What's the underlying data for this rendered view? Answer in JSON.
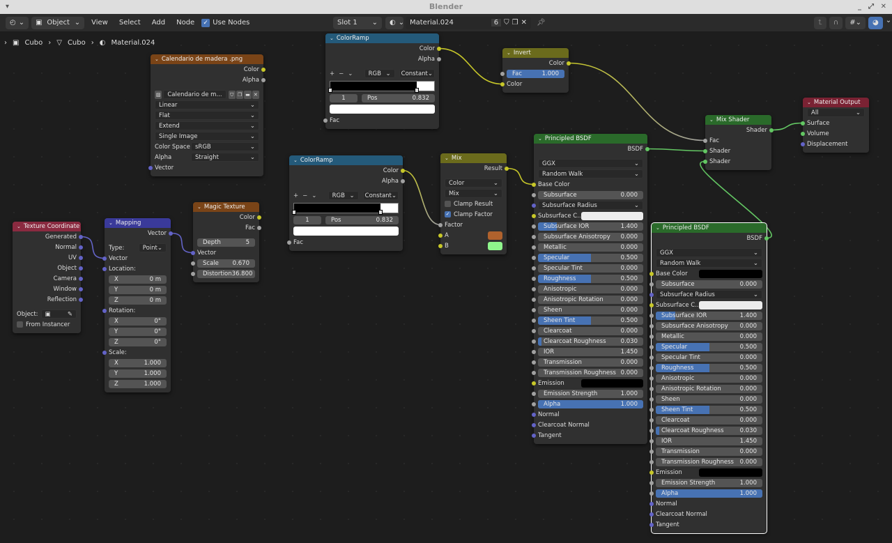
{
  "window": {
    "title": "Blender"
  },
  "header": {
    "editor_icon": "node-editor-icon",
    "object_mode": "Object",
    "menus": [
      "View",
      "Select",
      "Add",
      "Node"
    ],
    "use_nodes_label": "Use Nodes",
    "use_nodes": true,
    "slot": "Slot 1",
    "material": "Material.024",
    "users": "6"
  },
  "breadcrumb": [
    "Cubo",
    "Cubo",
    "Material.024"
  ],
  "colors": {
    "color_socket": "#c7c729",
    "float_socket": "#a1a1a1",
    "vector_socket": "#6363c7",
    "shader_socket": "#63c763",
    "link_default": "#c4c4c4",
    "accent": "#4772b3"
  },
  "nodes": [
    {
      "id": "image",
      "title": "Calendario de madera .png",
      "header": "#7a4417",
      "rows": [
        {
          "k": "out",
          "label": "Color",
          "socket": "color"
        },
        {
          "k": "out",
          "label": "Alpha",
          "socket": "float"
        },
        {
          "k": "gap"
        },
        {
          "k": "image",
          "label": "Calendario de m..."
        },
        {
          "k": "select",
          "label": "Linear"
        },
        {
          "k": "select",
          "label": "Flat"
        },
        {
          "k": "select",
          "label": "Extend"
        },
        {
          "k": "select",
          "label": "Single Image"
        },
        {
          "k": "prop",
          "label": "Color Space",
          "value": "sRGB"
        },
        {
          "k": "prop",
          "label": "Alpha",
          "value": "Straight"
        },
        {
          "k": "in",
          "label": "Vector",
          "socket": "vector"
        }
      ]
    },
    {
      "id": "ramp1",
      "title": "ColorRamp",
      "header": "#245a7a",
      "rows": [
        {
          "k": "out",
          "label": "Color",
          "socket": "color"
        },
        {
          "k": "out",
          "label": "Alpha",
          "socket": "float"
        },
        {
          "k": "gap"
        },
        {
          "k": "rampctl",
          "mode": "RGB",
          "interp": "Constant"
        },
        {
          "k": "ramp",
          "stops": [
            0,
            0.832
          ]
        },
        {
          "k": "rampstop",
          "index": "1",
          "pos_label": "Pos",
          "pos": "0.832"
        },
        {
          "k": "rampcolor",
          "color": "#ffffff"
        },
        {
          "k": "in",
          "label": "Fac",
          "socket": "float"
        }
      ]
    },
    {
      "id": "invert",
      "title": "Invert",
      "header": "#6b6b1c",
      "rows": [
        {
          "k": "out",
          "label": "Color",
          "socket": "color"
        },
        {
          "k": "value",
          "label": "Fac",
          "value": "1.000",
          "fill": 1,
          "socket": "float"
        },
        {
          "k": "in",
          "label": "Color",
          "socket": "color"
        }
      ]
    },
    {
      "id": "mixshader",
      "title": "Mix Shader",
      "header": "#2a6a2a",
      "rows": [
        {
          "k": "out",
          "label": "Shader",
          "socket": "shader"
        },
        {
          "k": "in",
          "label": "Fac",
          "socket": "float"
        },
        {
          "k": "in",
          "label": "Shader",
          "socket": "shader"
        },
        {
          "k": "in",
          "label": "Shader",
          "socket": "shader"
        }
      ]
    },
    {
      "id": "output",
      "title": "Material Output",
      "header": "#7a2233",
      "rows": [
        {
          "k": "select",
          "label": "All"
        },
        {
          "k": "in",
          "label": "Surface",
          "socket": "shader"
        },
        {
          "k": "in",
          "label": "Volume",
          "socket": "shader"
        },
        {
          "k": "in",
          "label": "Displacement",
          "socket": "vector"
        }
      ]
    },
    {
      "id": "texcoord",
      "title": "Texture Coordinate",
      "header": "#8a2a40",
      "rows": [
        {
          "k": "out",
          "label": "Generated",
          "socket": "vector"
        },
        {
          "k": "out",
          "label": "Normal",
          "socket": "vector"
        },
        {
          "k": "out",
          "label": "UV",
          "socket": "vector"
        },
        {
          "k": "out",
          "label": "Object",
          "socket": "vector"
        },
        {
          "k": "out",
          "label": "Camera",
          "socket": "vector"
        },
        {
          "k": "out",
          "label": "Window",
          "socket": "vector"
        },
        {
          "k": "out",
          "label": "Reflection",
          "socket": "vector"
        },
        {
          "k": "gap"
        },
        {
          "k": "object",
          "label": "Object:"
        },
        {
          "k": "check",
          "label": "From Instancer",
          "on": false
        }
      ]
    },
    {
      "id": "mapping",
      "title": "Mapping",
      "header": "#3a3a9a",
      "rows": [
        {
          "k": "out",
          "label": "Vector",
          "socket": "vector"
        },
        {
          "k": "gap"
        },
        {
          "k": "prop",
          "label": "Type:",
          "value": "Point"
        },
        {
          "k": "in",
          "label": "Vector",
          "socket": "vector"
        },
        {
          "k": "in",
          "label": "Location:",
          "socket": "vector"
        },
        {
          "k": "value",
          "label": "X",
          "value": "0 m"
        },
        {
          "k": "value",
          "label": "Y",
          "value": "0 m"
        },
        {
          "k": "value",
          "label": "Z",
          "value": "0 m"
        },
        {
          "k": "in",
          "label": "Rotation:",
          "socket": "vector"
        },
        {
          "k": "value",
          "label": "X",
          "value": "0°"
        },
        {
          "k": "value",
          "label": "Y",
          "value": "0°"
        },
        {
          "k": "value",
          "label": "Z",
          "value": "0°"
        },
        {
          "k": "in",
          "label": "Scale:",
          "socket": "vector"
        },
        {
          "k": "value",
          "label": "X",
          "value": "1.000"
        },
        {
          "k": "value",
          "label": "Y",
          "value": "1.000"
        },
        {
          "k": "value",
          "label": "Z",
          "value": "1.000"
        }
      ]
    },
    {
      "id": "magic",
      "title": "Magic Texture",
      "header": "#7a4417",
      "rows": [
        {
          "k": "out",
          "label": "Color",
          "socket": "color"
        },
        {
          "k": "out",
          "label": "Fac",
          "socket": "float"
        },
        {
          "k": "gap"
        },
        {
          "k": "value",
          "label": "Depth",
          "value": "5"
        },
        {
          "k": "in",
          "label": "Vector",
          "socket": "vector"
        },
        {
          "k": "value",
          "label": "Scale",
          "value": "0.670",
          "socket": "float"
        },
        {
          "k": "value",
          "label": "Distortion",
          "value": "36.800",
          "socket": "float"
        }
      ]
    },
    {
      "id": "ramp2",
      "title": "ColorRamp",
      "header": "#245a7a",
      "rows": [
        {
          "k": "out",
          "label": "Color",
          "socket": "color"
        },
        {
          "k": "out",
          "label": "Alpha",
          "socket": "float"
        },
        {
          "k": "gap"
        },
        {
          "k": "rampctl",
          "mode": "RGB",
          "interp": "Constant"
        },
        {
          "k": "ramp",
          "stops": [
            0,
            0.832
          ]
        },
        {
          "k": "rampstop",
          "index": "1",
          "pos_label": "Pos",
          "pos": "0.832"
        },
        {
          "k": "rampcolor",
          "color": "#ffffff"
        },
        {
          "k": "in",
          "label": "Fac",
          "socket": "float"
        }
      ]
    },
    {
      "id": "mix",
      "title": "Mix",
      "header": "#6b6b1c",
      "rows": [
        {
          "k": "out",
          "label": "Result",
          "socket": "color"
        },
        {
          "k": "gap"
        },
        {
          "k": "select",
          "label": "Color"
        },
        {
          "k": "select",
          "label": "Mix"
        },
        {
          "k": "check",
          "label": "Clamp Result",
          "on": false
        },
        {
          "k": "check",
          "label": "Clamp Factor",
          "on": true
        },
        {
          "k": "in",
          "label": "Factor",
          "socket": "float"
        },
        {
          "k": "swatchin",
          "label": "A",
          "color": "#b0622d",
          "socket": "color"
        },
        {
          "k": "swatchin",
          "label": "B",
          "color": "#8ff58c",
          "socket": "color"
        }
      ]
    },
    {
      "id": "bsdf1",
      "title": "Principled BSDF",
      "header": "#2a6a2a",
      "rows": [
        {
          "k": "out",
          "label": "BSDF",
          "socket": "shader"
        },
        {
          "k": "gap"
        },
        {
          "k": "select",
          "label": "GGX"
        },
        {
          "k": "select",
          "label": "Random Walk"
        },
        {
          "k": "in",
          "label": "Base Color",
          "socket": "color"
        },
        {
          "k": "value",
          "label": "Subsurface",
          "value": "0.000",
          "socket": "float"
        },
        {
          "k": "select",
          "label": "Subsurface Radius",
          "socket": "vector"
        },
        {
          "k": "swatchin",
          "label": "Subsurface C...",
          "color": "#ececec",
          "socket": "color"
        },
        {
          "k": "value",
          "label": "Subsurface IOR",
          "value": "1.400",
          "fill": 0.18,
          "socket": "float"
        },
        {
          "k": "value",
          "label": "Subsurface Anisotropy",
          "value": "0.000",
          "socket": "float"
        },
        {
          "k": "value",
          "label": "Metallic",
          "value": "0.000",
          "socket": "float"
        },
        {
          "k": "value",
          "label": "Specular",
          "value": "0.500",
          "fill": 0.5,
          "socket": "float"
        },
        {
          "k": "value",
          "label": "Specular Tint",
          "value": "0.000",
          "socket": "float"
        },
        {
          "k": "value",
          "label": "Roughness",
          "value": "0.500",
          "fill": 0.5,
          "socket": "float"
        },
        {
          "k": "value",
          "label": "Anisotropic",
          "value": "0.000",
          "socket": "float"
        },
        {
          "k": "value",
          "label": "Anisotropic Rotation",
          "value": "0.000",
          "socket": "float"
        },
        {
          "k": "value",
          "label": "Sheen",
          "value": "0.000",
          "socket": "float"
        },
        {
          "k": "value",
          "label": "Sheen Tint",
          "value": "0.500",
          "fill": 0.5,
          "socket": "float"
        },
        {
          "k": "value",
          "label": "Clearcoat",
          "value": "0.000",
          "socket": "float"
        },
        {
          "k": "value",
          "label": "Clearcoat Roughness",
          "value": "0.030",
          "fill": 0.03,
          "socket": "float"
        },
        {
          "k": "value",
          "label": "IOR",
          "value": "1.450",
          "socket": "float"
        },
        {
          "k": "value",
          "label": "Transmission",
          "value": "0.000",
          "socket": "float"
        },
        {
          "k": "value",
          "label": "Transmission Roughness",
          "value": "0.000",
          "socket": "float"
        },
        {
          "k": "swatchin",
          "label": "Emission",
          "color": "#000000",
          "socket": "color"
        },
        {
          "k": "value",
          "label": "Emission Strength",
          "value": "1.000",
          "socket": "float"
        },
        {
          "k": "value",
          "label": "Alpha",
          "value": "1.000",
          "fill": 1,
          "socket": "float"
        },
        {
          "k": "in",
          "label": "Normal",
          "socket": "vector"
        },
        {
          "k": "in",
          "label": "Clearcoat Normal",
          "socket": "vector"
        },
        {
          "k": "in",
          "label": "Tangent",
          "socket": "vector"
        }
      ]
    },
    {
      "id": "bsdf2",
      "title": "Principled BSDF",
      "header": "#2a6a2a",
      "selected": true,
      "rows": [
        {
          "k": "out",
          "label": "BSDF",
          "socket": "shader"
        },
        {
          "k": "gap"
        },
        {
          "k": "select",
          "label": "GGX"
        },
        {
          "k": "select",
          "label": "Random Walk"
        },
        {
          "k": "swatchin",
          "label": "Base Color",
          "color": "#000000",
          "socket": "color"
        },
        {
          "k": "value",
          "label": "Subsurface",
          "value": "0.000",
          "socket": "float"
        },
        {
          "k": "select",
          "label": "Subsurface Radius",
          "socket": "vector"
        },
        {
          "k": "swatchin",
          "label": "Subsurface C...",
          "color": "#ececec",
          "socket": "color"
        },
        {
          "k": "value",
          "label": "Subsurface IOR",
          "value": "1.400",
          "fill": 0.18,
          "socket": "float"
        },
        {
          "k": "value",
          "label": "Subsurface Anisotropy",
          "value": "0.000",
          "socket": "float"
        },
        {
          "k": "value",
          "label": "Metallic",
          "value": "0.000",
          "socket": "float"
        },
        {
          "k": "value",
          "label": "Specular",
          "value": "0.500",
          "fill": 0.5,
          "socket": "float"
        },
        {
          "k": "value",
          "label": "Specular Tint",
          "value": "0.000",
          "socket": "float"
        },
        {
          "k": "value",
          "label": "Roughness",
          "value": "0.500",
          "fill": 0.5,
          "socket": "float"
        },
        {
          "k": "value",
          "label": "Anisotropic",
          "value": "0.000",
          "socket": "float"
        },
        {
          "k": "value",
          "label": "Anisotropic Rotation",
          "value": "0.000",
          "socket": "float"
        },
        {
          "k": "value",
          "label": "Sheen",
          "value": "0.000",
          "socket": "float"
        },
        {
          "k": "value",
          "label": "Sheen Tint",
          "value": "0.500",
          "fill": 0.5,
          "socket": "float"
        },
        {
          "k": "value",
          "label": "Clearcoat",
          "value": "0.000",
          "socket": "float"
        },
        {
          "k": "value",
          "label": "Clearcoat Roughness",
          "value": "0.030",
          "fill": 0.03,
          "socket": "float"
        },
        {
          "k": "value",
          "label": "IOR",
          "value": "1.450",
          "socket": "float"
        },
        {
          "k": "value",
          "label": "Transmission",
          "value": "0.000",
          "socket": "float"
        },
        {
          "k": "value",
          "label": "Transmission Roughness",
          "value": "0.000",
          "socket": "float"
        },
        {
          "k": "swatchin",
          "label": "Emission",
          "color": "#000000",
          "socket": "color"
        },
        {
          "k": "value",
          "label": "Emission Strength",
          "value": "1.000",
          "socket": "float"
        },
        {
          "k": "value",
          "label": "Alpha",
          "value": "1.000",
          "fill": 1,
          "socket": "float"
        },
        {
          "k": "in",
          "label": "Normal",
          "socket": "vector"
        },
        {
          "k": "in",
          "label": "Clearcoat Normal",
          "socket": "vector"
        },
        {
          "k": "in",
          "label": "Tangent",
          "socket": "vector"
        }
      ]
    }
  ],
  "links": [
    {
      "from": [
        "image",
        0
      ],
      "to": [
        "ramp1",
        8
      ]
    },
    {
      "from": [
        "ramp1",
        0
      ],
      "to": [
        "invert",
        2
      ]
    },
    {
      "from": [
        "invert",
        0
      ],
      "to": [
        "mixshader",
        1
      ]
    },
    {
      "from": [
        "texcoord",
        0
      ],
      "to": [
        "mapping",
        3
      ]
    },
    {
      "from": [
        "mapping",
        0
      ],
      "to": [
        "magic",
        4
      ]
    },
    {
      "from": [
        "magic",
        0
      ],
      "to": [
        "ramp2",
        8
      ]
    },
    {
      "from": [
        "ramp2",
        0
      ],
      "to": [
        "mix",
        6
      ]
    },
    {
      "from": [
        "mix",
        0
      ],
      "to": [
        "bsdf1",
        4
      ]
    },
    {
      "from": [
        "bsdf1",
        0
      ],
      "to": [
        "mixshader",
        2
      ]
    },
    {
      "from": [
        "bsdf2",
        0
      ],
      "to": [
        "mixshader",
        3
      ]
    },
    {
      "from": [
        "mixshader",
        0
      ],
      "to": [
        "output",
        1
      ]
    }
  ]
}
